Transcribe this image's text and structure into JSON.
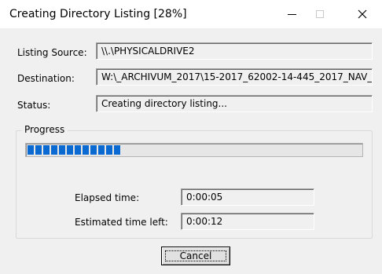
{
  "window": {
    "title": "Creating Directory Listing [28%]",
    "controls": {
      "minimize": "minimize",
      "maximize": "maximize",
      "close": "close"
    }
  },
  "form": {
    "listing_source_label": "Listing Source:",
    "listing_source_value": "\\\\.\\PHYSICALDRIVE2",
    "destination_label": "Destination:",
    "destination_value": "W:\\_ARCHIVUM_2017\\15-2017_62002-14-445_2017_NAV_",
    "status_label": "Status:",
    "status_value": "Creating directory listing..."
  },
  "progress": {
    "group_label": "Progress",
    "fraction": 0.28,
    "elapsed_label": "Elapsed time:",
    "elapsed_value": "0:00:05",
    "remaining_label": "Estimated time left:",
    "remaining_value": "0:00:12"
  },
  "buttons": {
    "cancel_label": "Cancel"
  },
  "colors": {
    "progress": "#0a6ad2",
    "window_bg": "#f0f0f0",
    "titlebar_bg": "#ffffff"
  }
}
